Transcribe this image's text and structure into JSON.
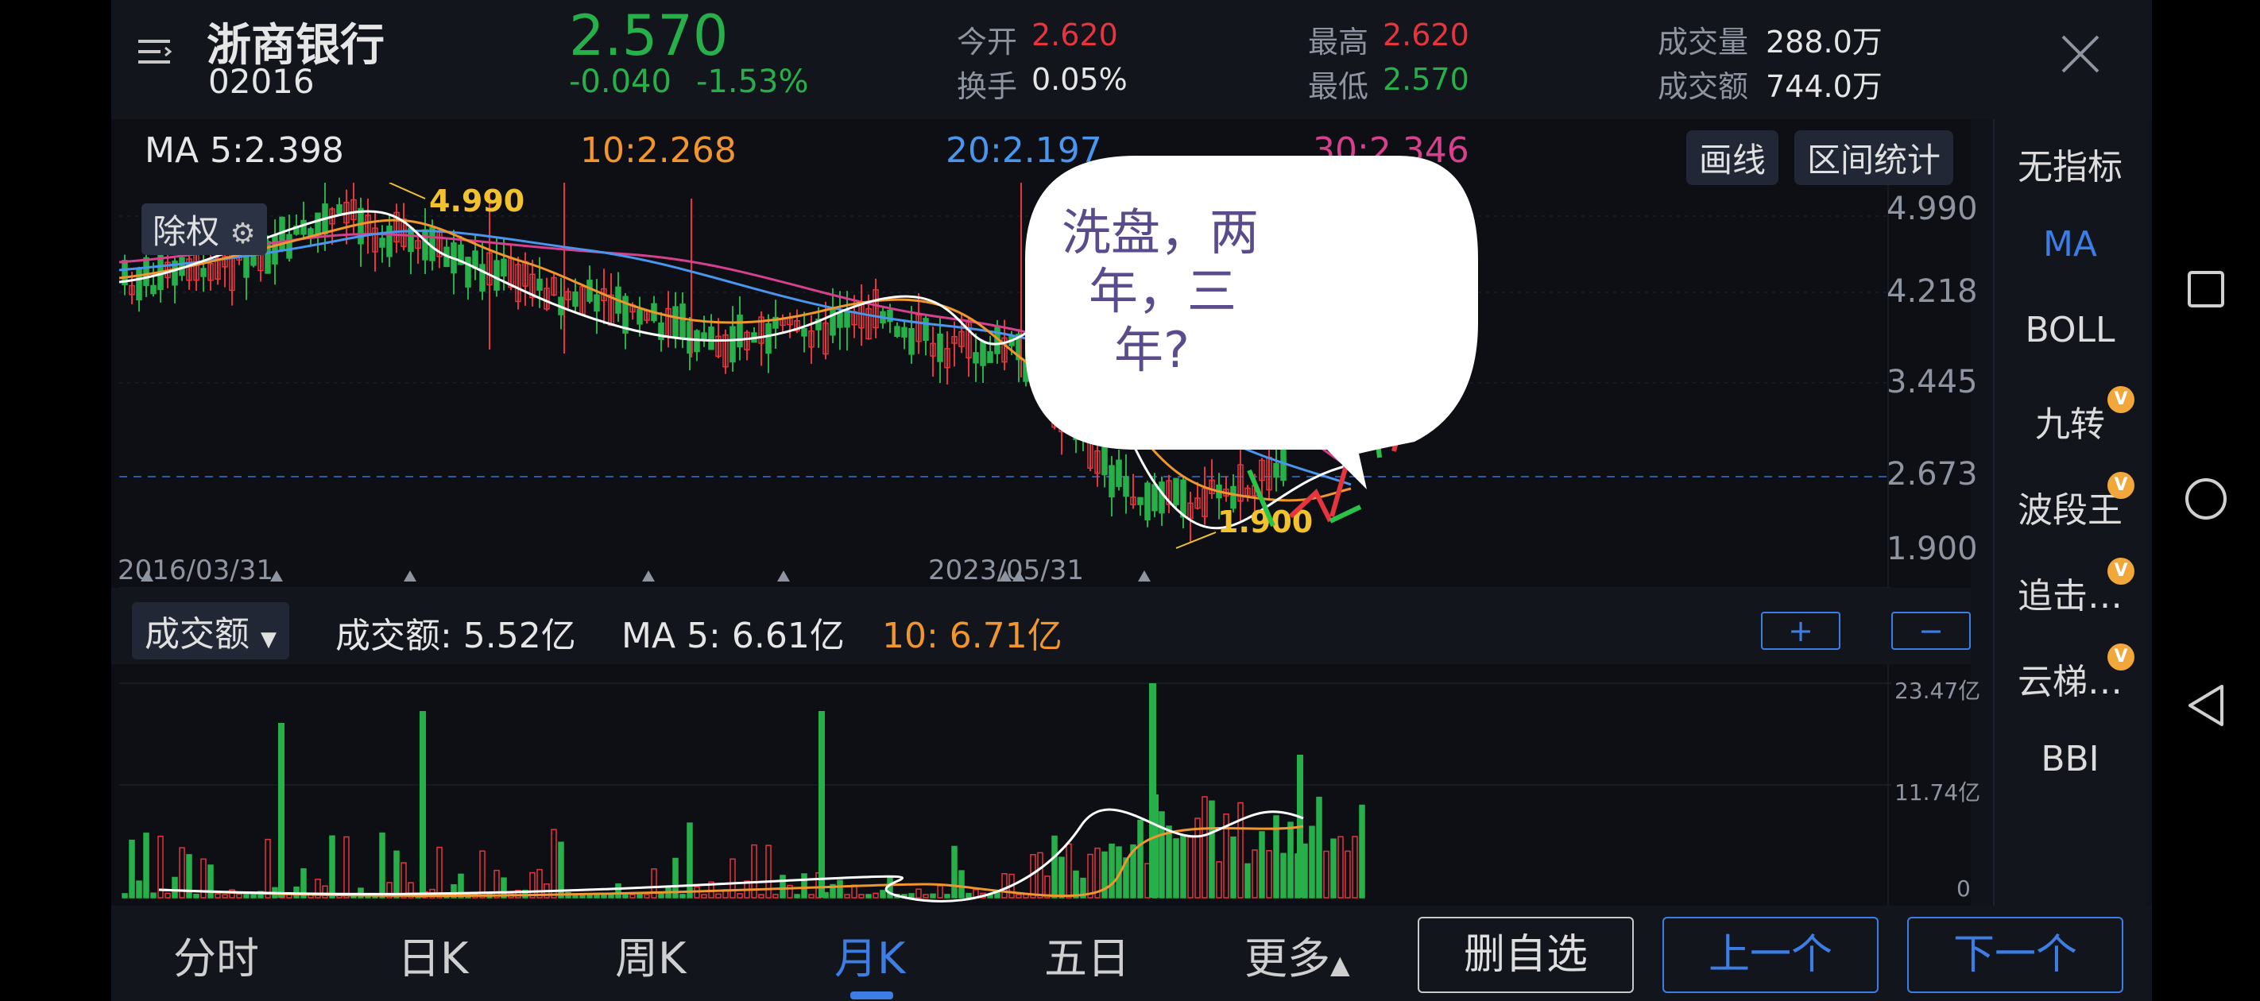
{
  "header": {
    "stock_name": "浙商银行",
    "stock_code": "02016",
    "price": "2.570",
    "change": "-0.040",
    "change_pct": "-1.53%",
    "open_label": "今开",
    "open_value": "2.620",
    "turnover_label": "换手",
    "turnover_value": "0.05%",
    "high_label": "最高",
    "high_value": "2.620",
    "low_label": "最低",
    "low_value": "2.570",
    "volume_label": "成交量",
    "volume_value": "288.0万",
    "amount_label": "成交额",
    "amount_value": "744.0万"
  },
  "ma_bar": {
    "ma5": "MA 5:2.398",
    "ma10": "10:2.268",
    "ma20": "20:2.197",
    "ma30": "30:2.346",
    "draw_line_btn": "画线",
    "interval_stats_btn": "区间统计"
  },
  "price_chart": {
    "adjust_label": "除权",
    "y_ticks": [
      "4.990",
      "4.218",
      "3.445",
      "2.673",
      "1.900"
    ],
    "x_ticks": [
      "2016/03/31",
      "2023/05/31"
    ],
    "high_annotation": "4.990",
    "low_annotation": "1.900",
    "bubble_text_line1": "洗盘，两",
    "bubble_text_line2": "年，三",
    "bubble_text_line3": "年?"
  },
  "volume_bar": {
    "selector_label": "成交额",
    "amount": "成交额: 5.52亿",
    "ma5": "MA 5: 6.61亿",
    "ma10": "10: 6.71亿",
    "plus_btn": "+",
    "minus_btn": "−"
  },
  "volume_chart": {
    "y_ticks": [
      "23.47亿",
      "11.74亿",
      "0"
    ]
  },
  "indicators": [
    "无指标",
    "MA",
    "BOLL",
    "九转",
    "波段王",
    "追击…",
    "云梯…",
    "BBI"
  ],
  "vip_badge": "V",
  "bottom_tabs": [
    "分时",
    "日K",
    "周K",
    "月K",
    "五日",
    "更多"
  ],
  "bottom_buttons": {
    "remove_watch": "删自选",
    "prev": "上一个",
    "next": "下一个"
  },
  "colors": {
    "up": "#e8343c",
    "down": "#27b04a",
    "ma5": "#ffffff",
    "ma10": "#f0962c",
    "ma20": "#4a96ee",
    "ma30": "#d6408c",
    "accent": "#3d7ee6",
    "annotation": "#f2c12e"
  },
  "chart_data": [
    {
      "type": "candlestick",
      "title": "",
      "xlabel": "",
      "ylabel": "",
      "ylim": [
        1.9,
        4.99
      ],
      "y_ticks": [
        4.99,
        4.218,
        3.445,
        2.673,
        1.9
      ],
      "x_ticks": [
        "2016/03/31",
        "2023/05/31"
      ],
      "reference_line": 2.673,
      "marked_high": 4.99,
      "marked_low": 1.9,
      "series": [
        {
          "name": "MA 5",
          "last": 2.398
        },
        {
          "name": "10",
          "last": 2.268
        },
        {
          "name": "20",
          "last": 2.197
        },
        {
          "name": "30",
          "last": 2.346
        }
      ]
    },
    {
      "type": "bar",
      "title": "",
      "ylim": [
        0,
        23.47
      ],
      "y_ticks": [
        "23.47亿",
        "11.74亿",
        "0"
      ],
      "series": [
        {
          "name": "成交额",
          "last": 5.52
        },
        {
          "name": "MA 5",
          "last": 6.61
        },
        {
          "name": "10",
          "last": 6.71
        }
      ]
    }
  ]
}
